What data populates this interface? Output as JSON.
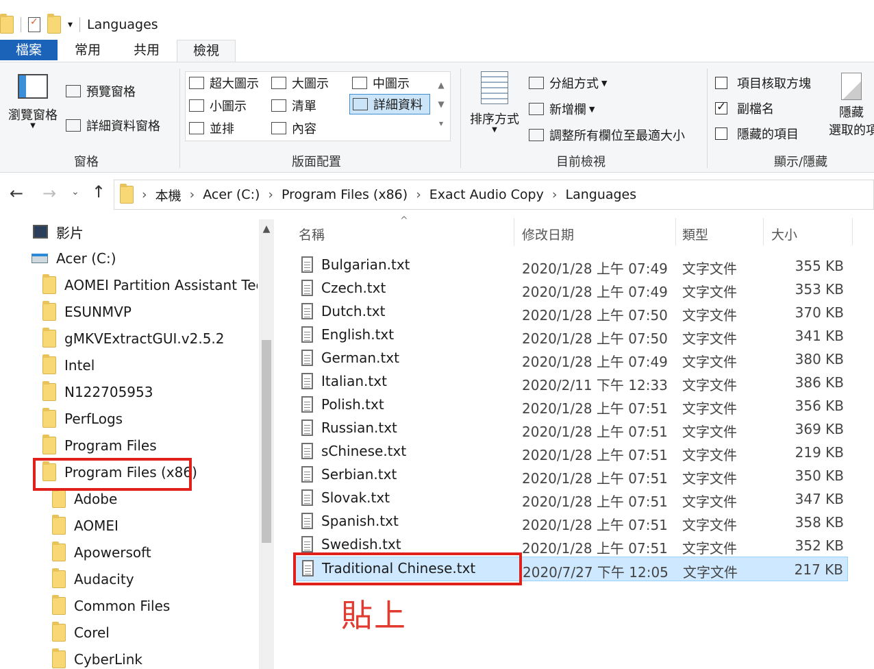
{
  "window": {
    "title": "Languages"
  },
  "ribbon": {
    "tabs": [
      "檔案",
      "常用",
      "共用",
      "檢視"
    ],
    "active_tab": "檢視",
    "panes_group": {
      "nav_pane": "瀏覽窗格",
      "preview_pane": "預覽窗格",
      "details_pane": "詳細資料窗格",
      "label": "窗格"
    },
    "layout_group": {
      "options": [
        [
          "超大圖示",
          "大圖示",
          "中圖示"
        ],
        [
          "小圖示",
          "清單",
          "詳細資料"
        ],
        [
          "並排",
          "內容",
          ""
        ]
      ],
      "selected": "詳細資料",
      "label": "版面配置"
    },
    "current_view_group": {
      "sort_by": "排序方式",
      "group_by": "分組方式",
      "add_columns": "新增欄",
      "size_columns": "調整所有欄位至最適大小",
      "label": "目前檢視"
    },
    "show_hide_group": {
      "item_checkboxes": "項目核取方塊",
      "item_checkboxes_checked": false,
      "file_extensions": "副檔名",
      "file_extensions_checked": true,
      "hidden_items": "隱藏的項目",
      "hidden_items_checked": false,
      "hide_selected_line1": "隱藏",
      "hide_selected_line2": "選取的項",
      "label": "顯示/隱藏"
    }
  },
  "address_bar": {
    "segments": [
      "本機",
      "Acer (C:)",
      "Program Files (x86)",
      "Exact Audio Copy",
      "Languages"
    ]
  },
  "nav_tree": {
    "items": [
      {
        "label": "影片",
        "level": 0,
        "icon": "video-icon"
      },
      {
        "label": "Acer (C:)",
        "level": 0,
        "icon": "drive-icon"
      },
      {
        "label": "AOMEI Partition Assistant Techi",
        "level": 1,
        "icon": "folder-icon"
      },
      {
        "label": "ESUNMVP",
        "level": 1,
        "icon": "folder-icon"
      },
      {
        "label": "gMKVExtractGUI.v2.5.2",
        "level": 1,
        "icon": "folder-icon"
      },
      {
        "label": "Intel",
        "level": 1,
        "icon": "folder-icon"
      },
      {
        "label": "N122705953",
        "level": 1,
        "icon": "folder-icon"
      },
      {
        "label": "PerfLogs",
        "level": 1,
        "icon": "folder-icon"
      },
      {
        "label": "Program Files",
        "level": 1,
        "icon": "folder-icon"
      },
      {
        "label": "Program Files (x86)",
        "level": 1,
        "icon": "folder-icon",
        "highlighted": true
      },
      {
        "label": "Adobe",
        "level": 2,
        "icon": "folder-icon"
      },
      {
        "label": "AOMEI",
        "level": 2,
        "icon": "folder-icon"
      },
      {
        "label": "Apowersoft",
        "level": 2,
        "icon": "folder-icon"
      },
      {
        "label": "Audacity",
        "level": 2,
        "icon": "folder-icon"
      },
      {
        "label": "Common Files",
        "level": 2,
        "icon": "folder-icon"
      },
      {
        "label": "Corel",
        "level": 2,
        "icon": "folder-icon"
      },
      {
        "label": "CyberLink",
        "level": 2,
        "icon": "folder-icon"
      }
    ]
  },
  "file_list": {
    "columns": [
      "名稱",
      "修改日期",
      "類型",
      "大小"
    ],
    "rows": [
      {
        "name": "Bulgarian.txt",
        "date": "2020/1/28 上午 07:49",
        "type": "文字文件",
        "size": "355 KB"
      },
      {
        "name": "Czech.txt",
        "date": "2020/1/28 上午 07:49",
        "type": "文字文件",
        "size": "353 KB"
      },
      {
        "name": "Dutch.txt",
        "date": "2020/1/28 上午 07:50",
        "type": "文字文件",
        "size": "370 KB"
      },
      {
        "name": "English.txt",
        "date": "2020/1/28 上午 07:50",
        "type": "文字文件",
        "size": "341 KB"
      },
      {
        "name": "German.txt",
        "date": "2020/1/28 上午 07:49",
        "type": "文字文件",
        "size": "380 KB"
      },
      {
        "name": "Italian.txt",
        "date": "2020/2/11 下午 12:33",
        "type": "文字文件",
        "size": "386 KB"
      },
      {
        "name": "Polish.txt",
        "date": "2020/1/28 上午 07:51",
        "type": "文字文件",
        "size": "356 KB"
      },
      {
        "name": "Russian.txt",
        "date": "2020/1/28 上午 07:51",
        "type": "文字文件",
        "size": "369 KB"
      },
      {
        "name": "sChinese.txt",
        "date": "2020/1/28 上午 07:51",
        "type": "文字文件",
        "size": "219 KB"
      },
      {
        "name": "Serbian.txt",
        "date": "2020/1/28 上午 07:51",
        "type": "文字文件",
        "size": "350 KB"
      },
      {
        "name": "Slovak.txt",
        "date": "2020/1/28 上午 07:51",
        "type": "文字文件",
        "size": "347 KB"
      },
      {
        "name": "Spanish.txt",
        "date": "2020/1/28 上午 07:51",
        "type": "文字文件",
        "size": "358 KB"
      },
      {
        "name": "Swedish.txt",
        "date": "2020/1/28 上午 07:51",
        "type": "文字文件",
        "size": "352 KB"
      },
      {
        "name": "Traditional Chinese.txt",
        "date": "2020/7/27 下午 12:05",
        "type": "文字文件",
        "size": "217 KB",
        "selected": true
      }
    ]
  },
  "annotation": {
    "text": "貼上",
    "color": "#e23a2e"
  },
  "colors": {
    "file_tab": "#1a63b8",
    "selection": "#cde8ff",
    "highlight_box": "#e0201b"
  }
}
